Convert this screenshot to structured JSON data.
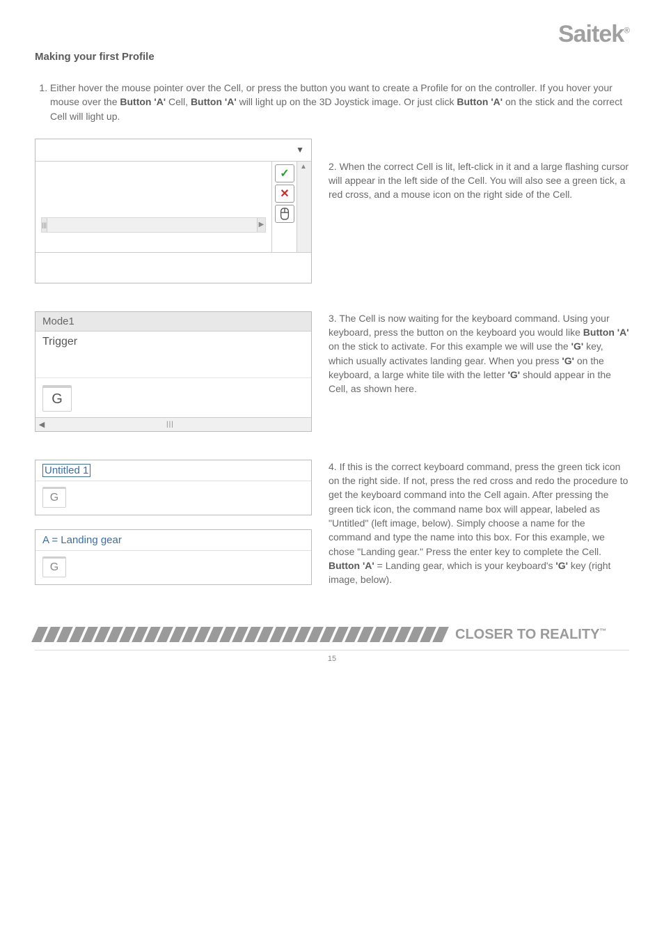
{
  "brand": "Saitek",
  "brand_mark": "®",
  "section_title": "Making your first Profile",
  "step1_prefix": "1.",
  "step1_a": "Either hover the mouse pointer over the Cell, or press the button you want to create a Profile for on the controller. If you hover your mouse over the ",
  "step1_btnA1": "Button 'A'",
  "step1_b": " Cell, ",
  "step1_btnA2": "Button 'A'",
  "step1_c": " will light up on the 3D Joystick image. Or just click ",
  "step1_btnA3": "Button 'A'",
  "step1_d": " on the stick and the correct Cell will light up.",
  "fig1": {
    "handle_left": "|||",
    "handle_right": "▶",
    "tick": "✓",
    "cross": "✕"
  },
  "para2": "2.   When the correct Cell is lit, left-click in it and a large flashing cursor will appear in the left side of the Cell. You will also see a green tick, a red cross, and a mouse icon on the right side of the Cell.",
  "fig2": {
    "mode": "Mode1",
    "trigger": "Trigger",
    "key": "G",
    "scroll_left": "◀",
    "scroll_thumb": "|||"
  },
  "para3_a": "3.   The Cell is now waiting for the keyboard command. Using your keyboard, press the button on the keyboard you would like ",
  "para3_btnA": "Button 'A'",
  "para3_b": " on the stick to activate. For this example we will use the ",
  "para3_g1": "'G'",
  "para3_c": " key, which usually activates landing gear. When you press ",
  "para3_g2": "'G'",
  "para3_d": " on the keyboard, a large white tile with the letter ",
  "para3_g3": "'G'",
  "para3_e": " should appear in the Cell, as shown here.",
  "fig3": {
    "title": "Untitled 1",
    "key": "G"
  },
  "fig4": {
    "title": "A = Landing gear",
    "key": "G"
  },
  "para4_a": "4.   If this is the correct keyboard command, press the green tick icon on the right side. If not, press the red cross and redo the procedure to get the keyboard command into the Cell again. After pressing the green tick icon, the command name box will appear, labeled as \"Untitled\" (left image, below). Simply choose a name for the command and type the name into this box. For this example, we chose \"Landing gear.\" Press the enter key to complete the Cell. ",
  "para4_btnA": "Button 'A'",
  "para4_b": " = Landing gear, which is your keyboard's ",
  "para4_g": "'G'",
  "para4_c": " key (right image, below).",
  "footer_text": "CLOSER TO REALITY",
  "footer_tm": "™",
  "page_number": "15"
}
